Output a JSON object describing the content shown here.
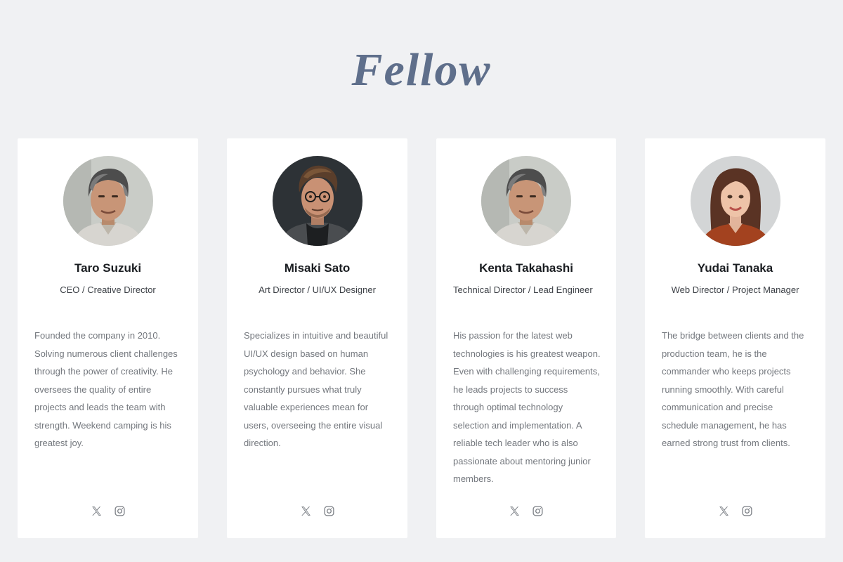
{
  "page": {
    "title": "Fellow"
  },
  "members": [
    {
      "name": "Taro Suzuki",
      "role": "CEO / Creative Director",
      "bio": "Founded the company in 2010. Solving numerous client challenges through the power of creativity. He oversees the quality of entire projects and leads the team with strength. Weekend camping is his greatest joy.",
      "avatar": "portrait-older-man-gray-hair"
    },
    {
      "name": "Misaki Sato",
      "role": "Art Director / UI/UX Designer",
      "bio": "Specializes in intuitive and beautiful UI/UX design based on human psychology and behavior. She constantly pursues what truly valuable experiences mean for users, overseeing the entire visual direction.",
      "avatar": "portrait-young-man-glasses"
    },
    {
      "name": "Kenta Takahashi",
      "role": "Technical Director / Lead Engineer",
      "bio": "His passion for the latest web technologies is his greatest weapon. Even with challenging requirements, he leads projects to success through optimal technology selection and implementation. A reliable tech leader who is also passionate about mentoring junior members.",
      "avatar": "portrait-older-man-gray-hair"
    },
    {
      "name": "Yudai Tanaka",
      "role": "Web Director / Project Manager",
      "bio": "The bridge between clients and the production team, he is the commander who keeps projects running smoothly. With careful communication and precise schedule management, he has earned strong trust from clients.",
      "avatar": "portrait-young-woman-red-hair"
    }
  ],
  "social_icons": [
    "x-icon",
    "instagram-icon"
  ],
  "colors": {
    "background": "#f0f1f3",
    "title": "#5f6f8b",
    "card": "#ffffff",
    "bio_text": "#73777d",
    "icon": "#7a7e84"
  }
}
